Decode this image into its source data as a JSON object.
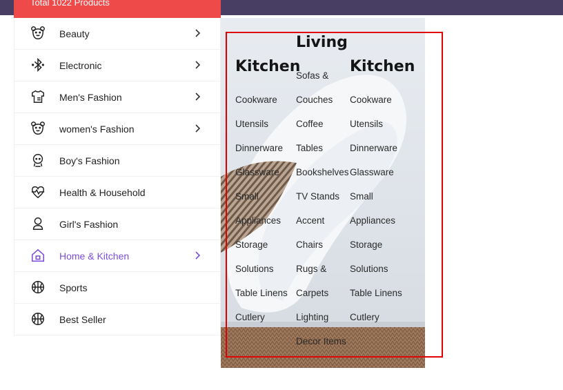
{
  "header": {
    "total_products": "Total 1022 Products"
  },
  "sidebar": {
    "items": [
      {
        "label": "Beauty",
        "icon": "bear-face-icon",
        "has_chevron": true
      },
      {
        "label": "Electronic",
        "icon": "bluetooth-icon",
        "has_chevron": true
      },
      {
        "label": "Men's Fashion",
        "icon": "tshirt-icon",
        "has_chevron": true
      },
      {
        "label": "women's Fashion",
        "icon": "bear-face-icon",
        "has_chevron": true
      },
      {
        "label": "Boy's Fashion",
        "icon": "child-face-icon",
        "has_chevron": false
      },
      {
        "label": "Health & Household",
        "icon": "heart-pulse-icon",
        "has_chevron": false
      },
      {
        "label": "Girl's Fashion",
        "icon": "person-icon",
        "has_chevron": false
      },
      {
        "label": "Home & Kitchen",
        "icon": "home-icon",
        "has_chevron": true,
        "active": true
      },
      {
        "label": "Sports",
        "icon": "basketball-icon",
        "has_chevron": false
      },
      {
        "label": "Best Seller",
        "icon": "basketball-icon",
        "has_chevron": false
      }
    ]
  },
  "mega_menu": {
    "columns": [
      {
        "title": "Kitchen",
        "links": [
          "Cookware",
          "Utensils",
          "Dinnerware",
          "Glassware",
          "Small",
          "Appliances",
          "Storage",
          "Solutions",
          "Table Linens",
          "Cutlery"
        ]
      },
      {
        "title": "Living",
        "links": [
          "Sofas &",
          "Couches",
          "Coffee",
          "Tables",
          "Bookshelves",
          "TV Stands",
          "Accent",
          "Chairs",
          "Rugs &",
          "Carpets",
          "Lighting",
          "Decor Items"
        ]
      },
      {
        "title": "Kitchen",
        "links": [
          "Cookware",
          "Utensils",
          "Dinnerware",
          "Glassware",
          "Small",
          "Appliances",
          "Storage",
          "Solutions",
          "Table Linens",
          "Cutlery"
        ]
      }
    ]
  },
  "colors": {
    "header_bar": "#483d62",
    "total_banner": "#ef4a4a",
    "active_item": "#7c4ddb",
    "focus_outline": "#e00000"
  }
}
